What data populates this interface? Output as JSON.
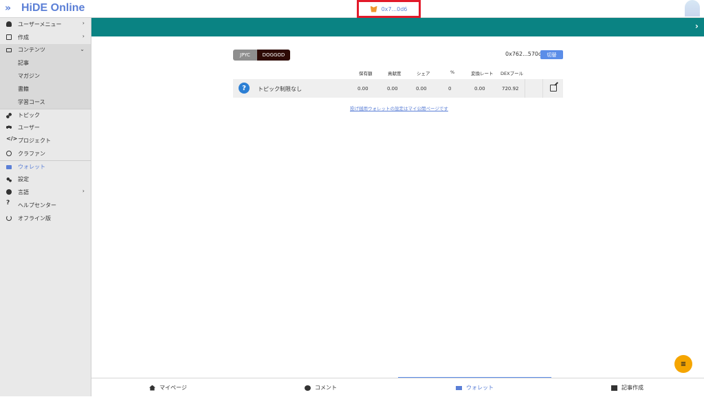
{
  "header": {
    "menu_glyph": "»",
    "logo": "HiDE Online",
    "wallet_address": "0x7...0d6"
  },
  "sidebar": {
    "items": [
      {
        "label": "ユーザーメニュー",
        "chevron": "›"
      },
      {
        "label": "作成",
        "chevron": "›"
      },
      {
        "label": "コンテンツ",
        "chevron": "⌄"
      },
      {
        "label": "記事"
      },
      {
        "label": "マガジン"
      },
      {
        "label": "書籍"
      },
      {
        "label": "学習コース"
      },
      {
        "label": "トピック"
      },
      {
        "label": "ユーザー"
      },
      {
        "label": "プロジェクト"
      },
      {
        "label": "クラファン"
      },
      {
        "label": "ウォレット"
      },
      {
        "label": "設定"
      },
      {
        "label": "言語",
        "chevron": "›"
      },
      {
        "label": "ヘルプセンター"
      },
      {
        "label": "オフライン版"
      }
    ]
  },
  "wallet": {
    "tabs": [
      "JPYC",
      "DOGGOD"
    ],
    "address": "0x762...570d6",
    "switch_label": "切替",
    "columns": [
      "保有額",
      "貢献度",
      "シェア",
      "%",
      "変換レート",
      "DEXプール"
    ],
    "row": {
      "name": "トピック制限なし",
      "values": [
        "0.00",
        "0.00",
        "0.00",
        "0",
        "0.00",
        "720.92"
      ]
    },
    "link_text": "投げ銭用ウォレットの設定はマイ公開ページです"
  },
  "bottom_nav": {
    "items": [
      "マイページ",
      "コメント",
      "ウォレット",
      "記事作成"
    ]
  },
  "colors": {
    "teal": "#0a8383",
    "accent": "#5b7fd6",
    "fab": "#f5a500",
    "highlight_border": "#e21a2a"
  }
}
